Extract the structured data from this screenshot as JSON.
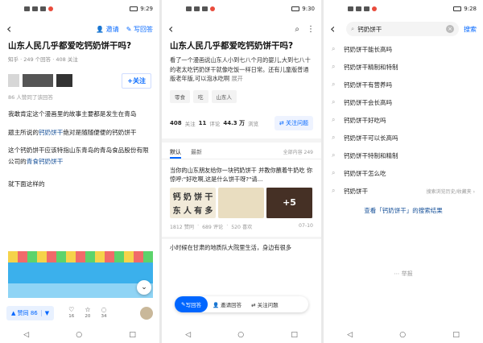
{
  "phone1": {
    "status_time": "9:29",
    "nav": {
      "invite": "邀请",
      "write": "写回答"
    },
    "question_title": "山东人民几乎都爱吃钙奶饼干吗?",
    "meta": "知乎 · 249 个回答 · 408 关注",
    "follow": "+关注",
    "likes_note": "86 人赞同了该回答",
    "para1": "我敢肯定这个漫画里的故事主要都是发生在青岛",
    "para2_pre": "题主所说的",
    "para2_link": "钙奶饼干",
    "para2_post": "绝对是随随便便的钙奶饼干",
    "para3_pre": "这个钙奶饼干应该特指山东青岛的青岛食品股份有限公司的",
    "para3_link": "青食钙奶饼干",
    "para4": "就下面这样的",
    "vote_label": "▲ 赞同 86",
    "actions": [
      {
        "icon": "heart-icon",
        "glyph": "♡",
        "count": "16"
      },
      {
        "icon": "star-icon",
        "glyph": "☆",
        "count": "20"
      },
      {
        "icon": "comment-icon",
        "glyph": "◌",
        "count": "34"
      }
    ]
  },
  "phone2": {
    "status_time": "9:30",
    "question_title": "山东人民几乎都爱吃钙奶饼干吗?",
    "desc": "看了一个漫画说山东人小到七八个月的婴儿,大到七八十的老太吃钙奶饼干就像吃饭一样日常。还有儿童版普通版老年版,可以泡水吃啊",
    "desc_more": "展开",
    "tags": [
      "零食",
      "吃",
      "山东人"
    ],
    "stats": {
      "follow_n": "408",
      "follow_l": "关注",
      "ans_n": "11",
      "ans_l": "评论",
      "views_n": "44.3 万",
      "views_l": "浏览"
    },
    "follow_q": "关注问题",
    "tabs": {
      "default": "默认",
      "latest": "最新",
      "all": "全部内容 249"
    },
    "card_text": "当你的山东朋友给你一块钙奶饼干 并教你蘸着牛奶吃 你惊呼:\"好吃啊,这是什么饼干呀?\"请...",
    "img_chars": [
      "钙",
      "奶",
      "饼",
      "干",
      "东",
      "人",
      "有",
      "多"
    ],
    "img_more": "+5",
    "card_stats": {
      "a": "1812 赞同",
      "b": "689 评论",
      "c": "520 喜欢",
      "date": "07-10"
    },
    "card2": "小时候在甘肃的地质队大院里生活，身边有很多",
    "floatbar": {
      "write": "写回答",
      "invite": "邀请回答",
      "follow": "关注问题"
    }
  },
  "phone3": {
    "status_time": "9:28",
    "query": "钙奶饼干",
    "search_btn": "搜索",
    "suggestions": [
      {
        "hl": "钙奶饼干",
        "tail": "能长高吗"
      },
      {
        "hl": "钙奶饼干",
        "tail": "精制和特制"
      },
      {
        "hl": "钙奶饼干",
        "tail": "有营养吗"
      },
      {
        "hl": "钙奶饼干",
        "tail": "会长高吗"
      },
      {
        "hl": "钙奶饼干",
        "tail": "好吃吗"
      },
      {
        "hl": "钙奶饼干",
        "tail": "可以长高吗"
      },
      {
        "hl": "钙奶饼干",
        "tail": "特制和精制"
      },
      {
        "hl": "钙奶饼干",
        "tail": "怎么吃"
      },
      {
        "hl": "钙奶饼干",
        "tail": "",
        "hint": "搜索浏览历史/收藏夹 ›"
      }
    ],
    "view_results": "查看「钙奶饼干」的搜索结果",
    "report": "举报"
  },
  "sysnav": {
    "back": "◁",
    "home": "○",
    "recent": "□"
  }
}
